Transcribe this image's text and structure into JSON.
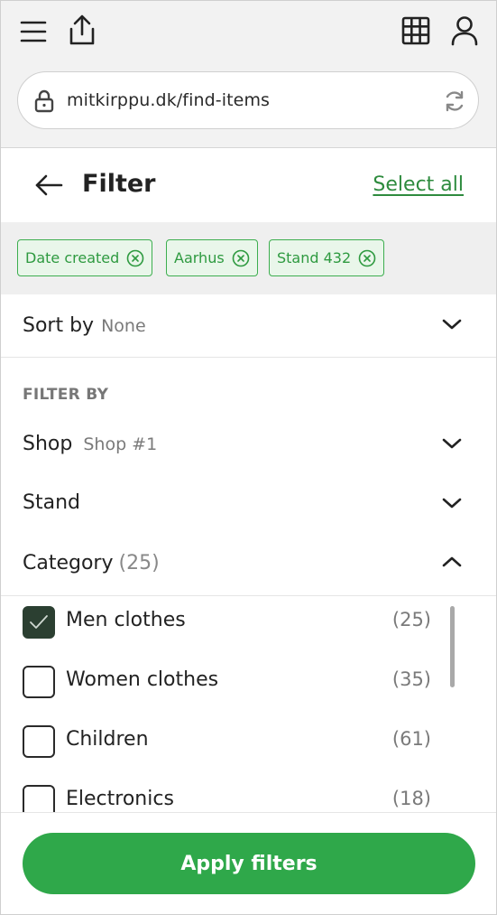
{
  "browser": {
    "url": "mitkirppu.dk/find-items"
  },
  "filter": {
    "title": "Filter",
    "select_all": "Select all"
  },
  "chips": [
    {
      "label": "Date created"
    },
    {
      "label": "Aarhus"
    },
    {
      "label": "Stand 432"
    }
  ],
  "sort": {
    "label": "Sort by",
    "value": "None"
  },
  "filter_by": {
    "heading": "FILTER BY",
    "shop": {
      "label": "Shop",
      "value": "Shop #1"
    },
    "stand": {
      "label": "Stand"
    },
    "category": {
      "label": "Category",
      "count": "(25)",
      "options": [
        {
          "label": "Men clothes",
          "count": "(25)",
          "checked": true
        },
        {
          "label": "Women clothes",
          "count": "(35)",
          "checked": false
        },
        {
          "label": "Children",
          "count": "(61)",
          "checked": false
        },
        {
          "label": "Electronics",
          "count": "(18)",
          "checked": false
        }
      ]
    }
  },
  "footer": {
    "apply_label": "Apply filters"
  },
  "colors": {
    "accent": "#2fa84a",
    "chip_border": "#3dae4f",
    "checked_box": "#2b3f31"
  }
}
